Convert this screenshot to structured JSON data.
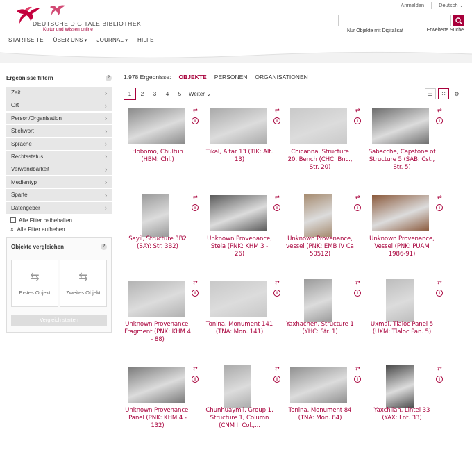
{
  "header": {
    "logo_title": "DEUTSCHE DIGITALE BIBLIOTHEK",
    "logo_subtitle": "Kultur und Wissen online",
    "login": "Anmelden",
    "language": "Deutsch",
    "search_placeholder": "",
    "digitalisat_label": "Nur Objekte mit Digitalisat",
    "advanced_search": "Erweiterte Suche",
    "nav": [
      "STARTSEITE",
      "ÜBER UNS",
      "JOURNAL",
      "HILFE"
    ]
  },
  "sidebar": {
    "title": "Ergebnisse filtern",
    "help": "?",
    "filters": [
      "Zeit",
      "Ort",
      "Person/Organisation",
      "Stichwort",
      "Sprache",
      "Rechtsstatus",
      "Verwendbarkeit",
      "Medientyp",
      "Sparte",
      "Datengeber"
    ],
    "keep_filters": "Alle Filter beibehalten",
    "clear_filters": "Alle Filter aufheben",
    "compare_title": "Objekte vergleichen",
    "first_object": "Erstes Objekt",
    "second_object": "Zweites Objekt",
    "compare_button": "Vergleich starten"
  },
  "results": {
    "count": "1.978 Ergebnisse:",
    "tabs": [
      "OBJEKTE",
      "PERSONEN",
      "ORGANISATIONEN"
    ],
    "pages": [
      "1",
      "2",
      "3",
      "4",
      "5"
    ],
    "next": "Weiter",
    "items": [
      {
        "title": "Hobomo, Chultun (HBM: Chl.)"
      },
      {
        "title": "Tikal, Altar 13 (TIK: Alt. 13)"
      },
      {
        "title": "Chicanna, Structure 20, Bench (CHC: Bnc., Str. 20)"
      },
      {
        "title": "Sabacche, Capstone of Structure 5 (SAB: Cst., Str. 5)"
      },
      {
        "title": "Sayil, Structure 3B2 (SAY: Str. 3B2)"
      },
      {
        "title": "Unknown Provenance, Stela (PNK: KHM 3 - 26)"
      },
      {
        "title": "Unknown Provenance, vessel (PNK: EMB IV Ca 50512)"
      },
      {
        "title": "Unknown Provenance, Vessel (PNK: PUAM 1986-91)"
      },
      {
        "title": "Unknown Provenance, Fragment (PNK: KHM 4 - 88)"
      },
      {
        "title": "Tonina, Monument 141 (TNA: Mon. 141)"
      },
      {
        "title": "Yaxhachen, Structure 1 (YHC: Str. 1)"
      },
      {
        "title": "Uxmal, Tlaloc Panel 5 (UXM: Tlaloc Pan. 5)"
      },
      {
        "title": "Unknown Provenance, Panel (PNK: KHM 4 - 132)"
      },
      {
        "title": "Chunhuaymil, Group 1, Structure 1, Column (CNM I: Col.,..."
      },
      {
        "title": "Tonina, Monument 84 (TNA: Mon. 84)"
      },
      {
        "title": "Yaxchilan, Lintel 33 (YAX: Lnt. 33)"
      }
    ]
  },
  "colors": {
    "accent": "#a8003b"
  }
}
